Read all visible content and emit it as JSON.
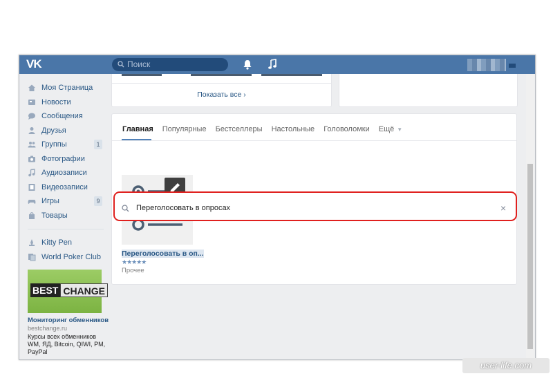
{
  "header": {
    "logo": "VK",
    "search_placeholder": "Поиск",
    "icons": [
      "search-icon",
      "bell-icon",
      "music-icon"
    ]
  },
  "sidebar": {
    "items": [
      {
        "label": "Моя Страница",
        "icon": "home-icon"
      },
      {
        "label": "Новости",
        "icon": "news-icon"
      },
      {
        "label": "Сообщения",
        "icon": "messages-icon"
      },
      {
        "label": "Друзья",
        "icon": "friends-icon"
      },
      {
        "label": "Группы",
        "icon": "groups-icon",
        "count": "1"
      },
      {
        "label": "Фотографии",
        "icon": "camera-icon"
      },
      {
        "label": "Аудиозаписи",
        "icon": "music-icon"
      },
      {
        "label": "Видеозаписи",
        "icon": "video-icon"
      },
      {
        "label": "Игры",
        "icon": "gamepad-icon",
        "count": "9"
      },
      {
        "label": "Товары",
        "icon": "bag-icon"
      }
    ],
    "apps": [
      {
        "label": "Kitty Pen",
        "icon": "kitty-pen-icon"
      },
      {
        "label": "World Poker Club",
        "icon": "poker-icon"
      }
    ],
    "ad": {
      "logo_left": "BEST",
      "logo_right": "CHANGE",
      "title": "Мониторинг обменников",
      "domain": "bestchange.ru",
      "text": "Курсы всех обменников WM, ЯД, Bitcoin, QIWI, PM, PayPal"
    }
  },
  "top_card": {
    "show_all": "Показать все ›"
  },
  "tabs": [
    "Главная",
    "Популярные",
    "Бестселлеры",
    "Настольные",
    "Головоломки",
    "Ещё"
  ],
  "app_search": {
    "value": "Переголосовать в опросах"
  },
  "result": {
    "name": "Переголосовать в оп...",
    "stars": "★★★★★",
    "category": "Прочее"
  },
  "watermark": "user-life.com",
  "colors": {
    "header": "#4a76a8",
    "link": "#2a5885",
    "highlight": "#e0201e"
  }
}
